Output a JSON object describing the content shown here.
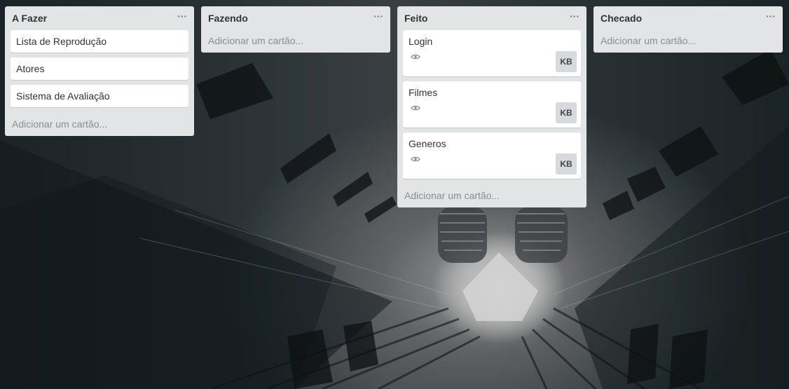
{
  "board": {
    "lists": [
      {
        "title": "A Fazer",
        "menu": "···",
        "cards": [
          {
            "title": "Lista de Reprodução"
          },
          {
            "title": "Atores"
          },
          {
            "title": "Sistema de Avaliação"
          }
        ],
        "add_label": "Adicionar um cartão..."
      },
      {
        "title": "Fazendo",
        "menu": "···",
        "cards": [],
        "add_label": "Adicionar um cartão..."
      },
      {
        "title": "Feito",
        "menu": "···",
        "cards": [
          {
            "title": "Login",
            "icon": "eye-icon",
            "member": "KB"
          },
          {
            "title": "Filmes",
            "icon": "eye-icon",
            "member": "KB"
          },
          {
            "title": "Generos",
            "icon": "eye-icon",
            "member": "KB"
          }
        ],
        "add_label": "Adicionar um cartão..."
      },
      {
        "title": "Checado",
        "menu": "···",
        "cards": [],
        "add_label": "Adicionar um cartão..."
      }
    ]
  },
  "colors": {
    "list_bg": "#e2e4e6",
    "card_bg": "#ffffff",
    "member_bg": "#d6dadc",
    "muted_text": "#8c8c8c"
  }
}
